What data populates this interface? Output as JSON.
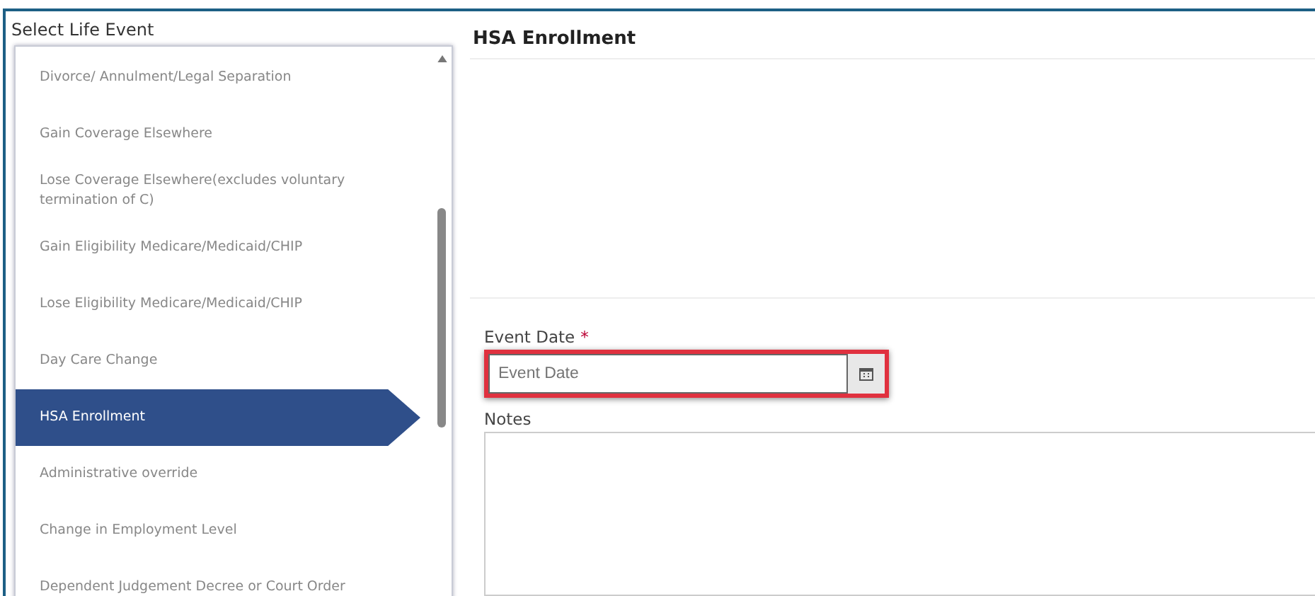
{
  "left_panel": {
    "title": "Select Life Event",
    "items": [
      {
        "label": "Divorce/ Annulment/Legal Separation",
        "selected": false
      },
      {
        "label": "Gain Coverage Elsewhere",
        "selected": false
      },
      {
        "label": "Lose Coverage Elsewhere(excludes voluntary termination of C)",
        "selected": false
      },
      {
        "label": "Gain Eligibility Medicare/Medicaid/CHIP",
        "selected": false
      },
      {
        "label": "Lose Eligibility Medicare/Medicaid/CHIP",
        "selected": false
      },
      {
        "label": "Day Care Change",
        "selected": false
      },
      {
        "label": "HSA Enrollment",
        "selected": true
      },
      {
        "label": "Administrative override",
        "selected": false
      },
      {
        "label": "Change in Employment Level",
        "selected": false
      },
      {
        "label": "Dependent Judgement Decree or Court Order",
        "selected": false
      }
    ]
  },
  "detail": {
    "title": "HSA Enrollment",
    "event_date": {
      "label": "Event Date",
      "required_mark": "*",
      "placeholder": "Event Date",
      "highlighted": true
    },
    "notes": {
      "label": "Notes"
    }
  }
}
